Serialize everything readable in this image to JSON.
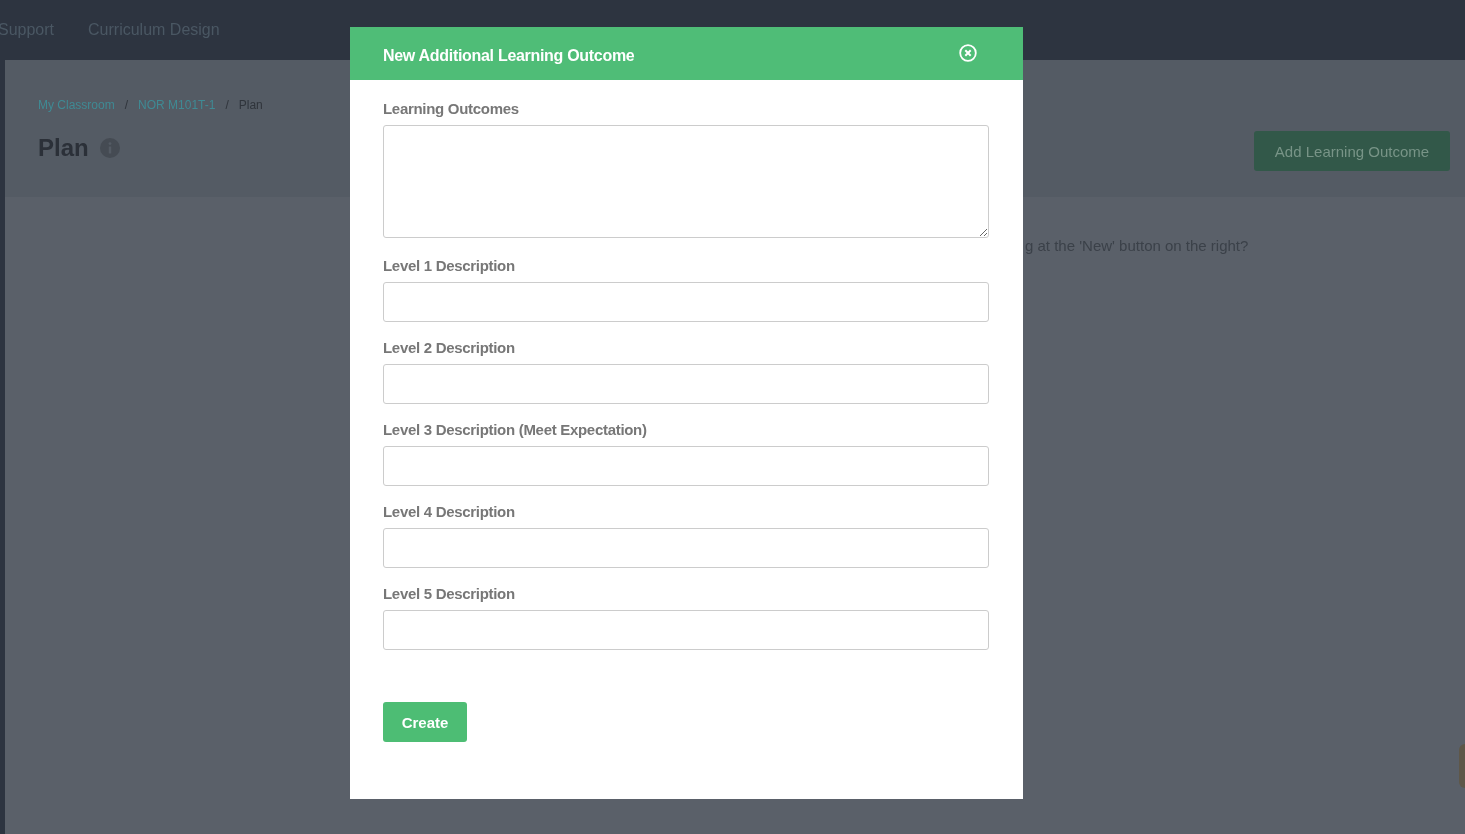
{
  "navbar": {
    "links": [
      {
        "label": "Support"
      },
      {
        "label": "Curriculum Design"
      }
    ]
  },
  "breadcrumb": [
    {
      "label": "My Classroom",
      "kind": "link"
    },
    {
      "label": "NOR M101T-1",
      "kind": "link"
    },
    {
      "label": "Plan",
      "kind": "current"
    }
  ],
  "breadcrumb_separator": "/",
  "page_title": "Plan",
  "add_button": "Add Learning Outcome",
  "empty_message": "g at the 'New' button on the right?",
  "modal": {
    "title": "New Additional Learning Outcome",
    "fields": [
      {
        "label": "Learning Outcomes",
        "kind": "textarea"
      },
      {
        "label": "Level 1 Description",
        "kind": "input"
      },
      {
        "label": "Level 2 Description",
        "kind": "input"
      },
      {
        "label": "Level 3 Description (Meet Expectation)",
        "kind": "input"
      },
      {
        "label": "Level 4 Description",
        "kind": "input"
      },
      {
        "label": "Level 5 Description",
        "kind": "input"
      }
    ],
    "submit": "Create"
  }
}
